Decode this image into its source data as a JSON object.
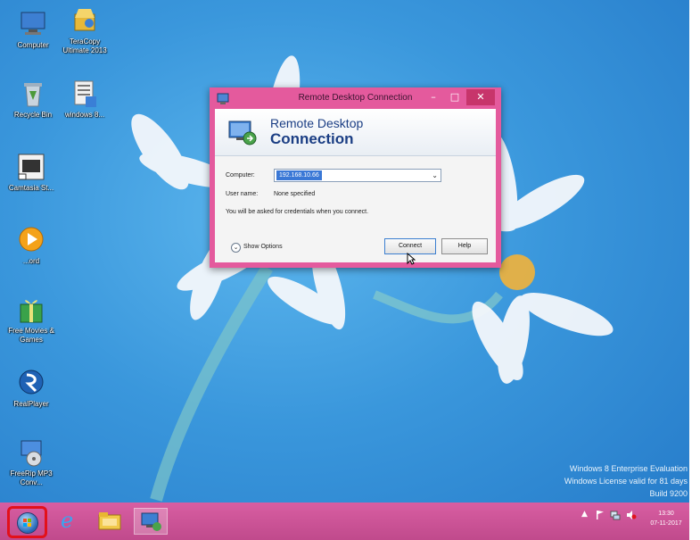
{
  "desktop": {
    "icons": [
      {
        "label": "Computer"
      },
      {
        "label": "TeraCopy Ultimate 2013"
      },
      {
        "label": "Recycle Bin"
      },
      {
        "label": "windows 8..."
      },
      {
        "label": "Camtasia St..."
      },
      {
        "label": "...ord"
      },
      {
        "label": "Free Movies & Games"
      },
      {
        "label": "RealPlayer"
      },
      {
        "label": "FreeRip MP3 Conv..."
      }
    ]
  },
  "rdp_window": {
    "title": "Remote Desktop Connection",
    "banner_line1": "Remote Desktop",
    "banner_line2": "Connection",
    "computer_label": "Computer:",
    "computer_value": "192.168.10.66",
    "username_label": "User name:",
    "username_value": "None specified",
    "credentials_note": "You will be asked for credentials when you connect.",
    "show_options": "Show Options",
    "connect_button": "Connect",
    "help_button": "Help",
    "minimize_glyph": "–",
    "maximize_glyph": "□",
    "close_glyph": "✕"
  },
  "watermark": {
    "line1": "Windows 8 Enterprise Evaluation",
    "line2": "Windows License valid for 81 days",
    "line3": "Build 9200"
  },
  "taskbar": {
    "clock_time": "13:30",
    "clock_date": "07-11-2017",
    "tray_arrow": "▲"
  },
  "colors": {
    "taskbar": "#c9509a",
    "window_frame": "#e45a9d",
    "highlight_box": "#e3101a",
    "desktop": "#3a97dc"
  }
}
